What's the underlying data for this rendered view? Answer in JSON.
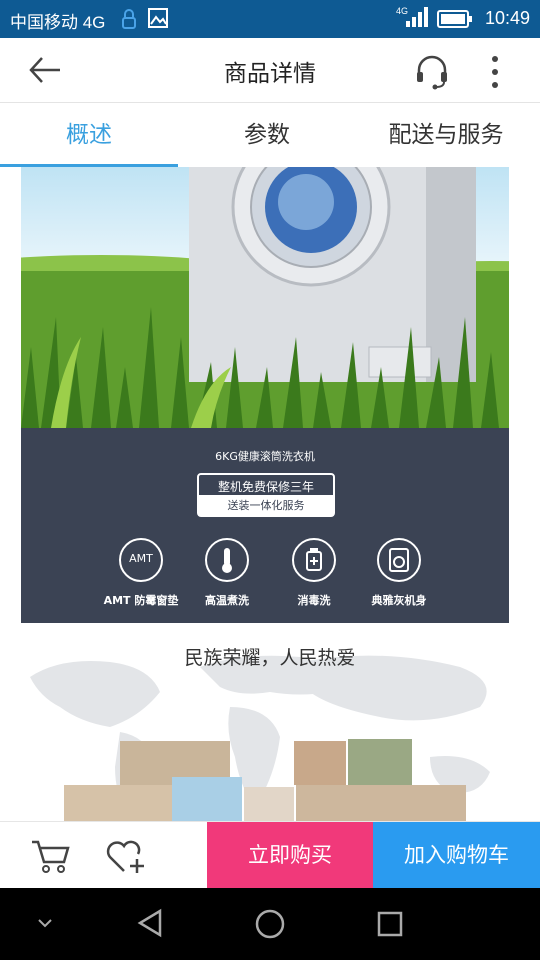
{
  "status_bar": {
    "carrier": "中国移动 4G",
    "network": "4G",
    "time": "10:49"
  },
  "header": {
    "title": "商品详情",
    "back_icon": "arrow-left-icon",
    "service_icon": "headset-icon",
    "more_icon": "more-vertical-icon"
  },
  "tabs": [
    {
      "label": "概述",
      "active": true
    },
    {
      "label": "参数",
      "active": false
    },
    {
      "label": "配送与服务",
      "active": false
    }
  ],
  "banner": {
    "product_name": "6KG健康滚筒洗衣机",
    "warranty": "整机免费保修三年",
    "delivery": "送装一体化服务",
    "features": [
      {
        "icon_text": "AMT",
        "label": "AMT 防霉窗垫",
        "icon": "amt-icon"
      },
      {
        "label": "高温煮洗",
        "icon": "thermometer-icon"
      },
      {
        "label": "消毒洗",
        "icon": "disinfect-bottle-icon"
      },
      {
        "label": "典雅灰机身",
        "icon": "washer-icon"
      }
    ]
  },
  "map_section": {
    "slogan": "民族荣耀，人民热爱"
  },
  "bottom_bar": {
    "cart_icon": "cart-icon",
    "favorite_icon": "heart-plus-icon",
    "buy_now": "立即购买",
    "add_to_cart": "加入购物车"
  },
  "colors": {
    "status_bar": "#0e5a93",
    "accent": "#3aa0df",
    "buy_now": "#f1397a",
    "add_to_cart": "#2a9bf0",
    "banner_dark": "#3b4354"
  }
}
